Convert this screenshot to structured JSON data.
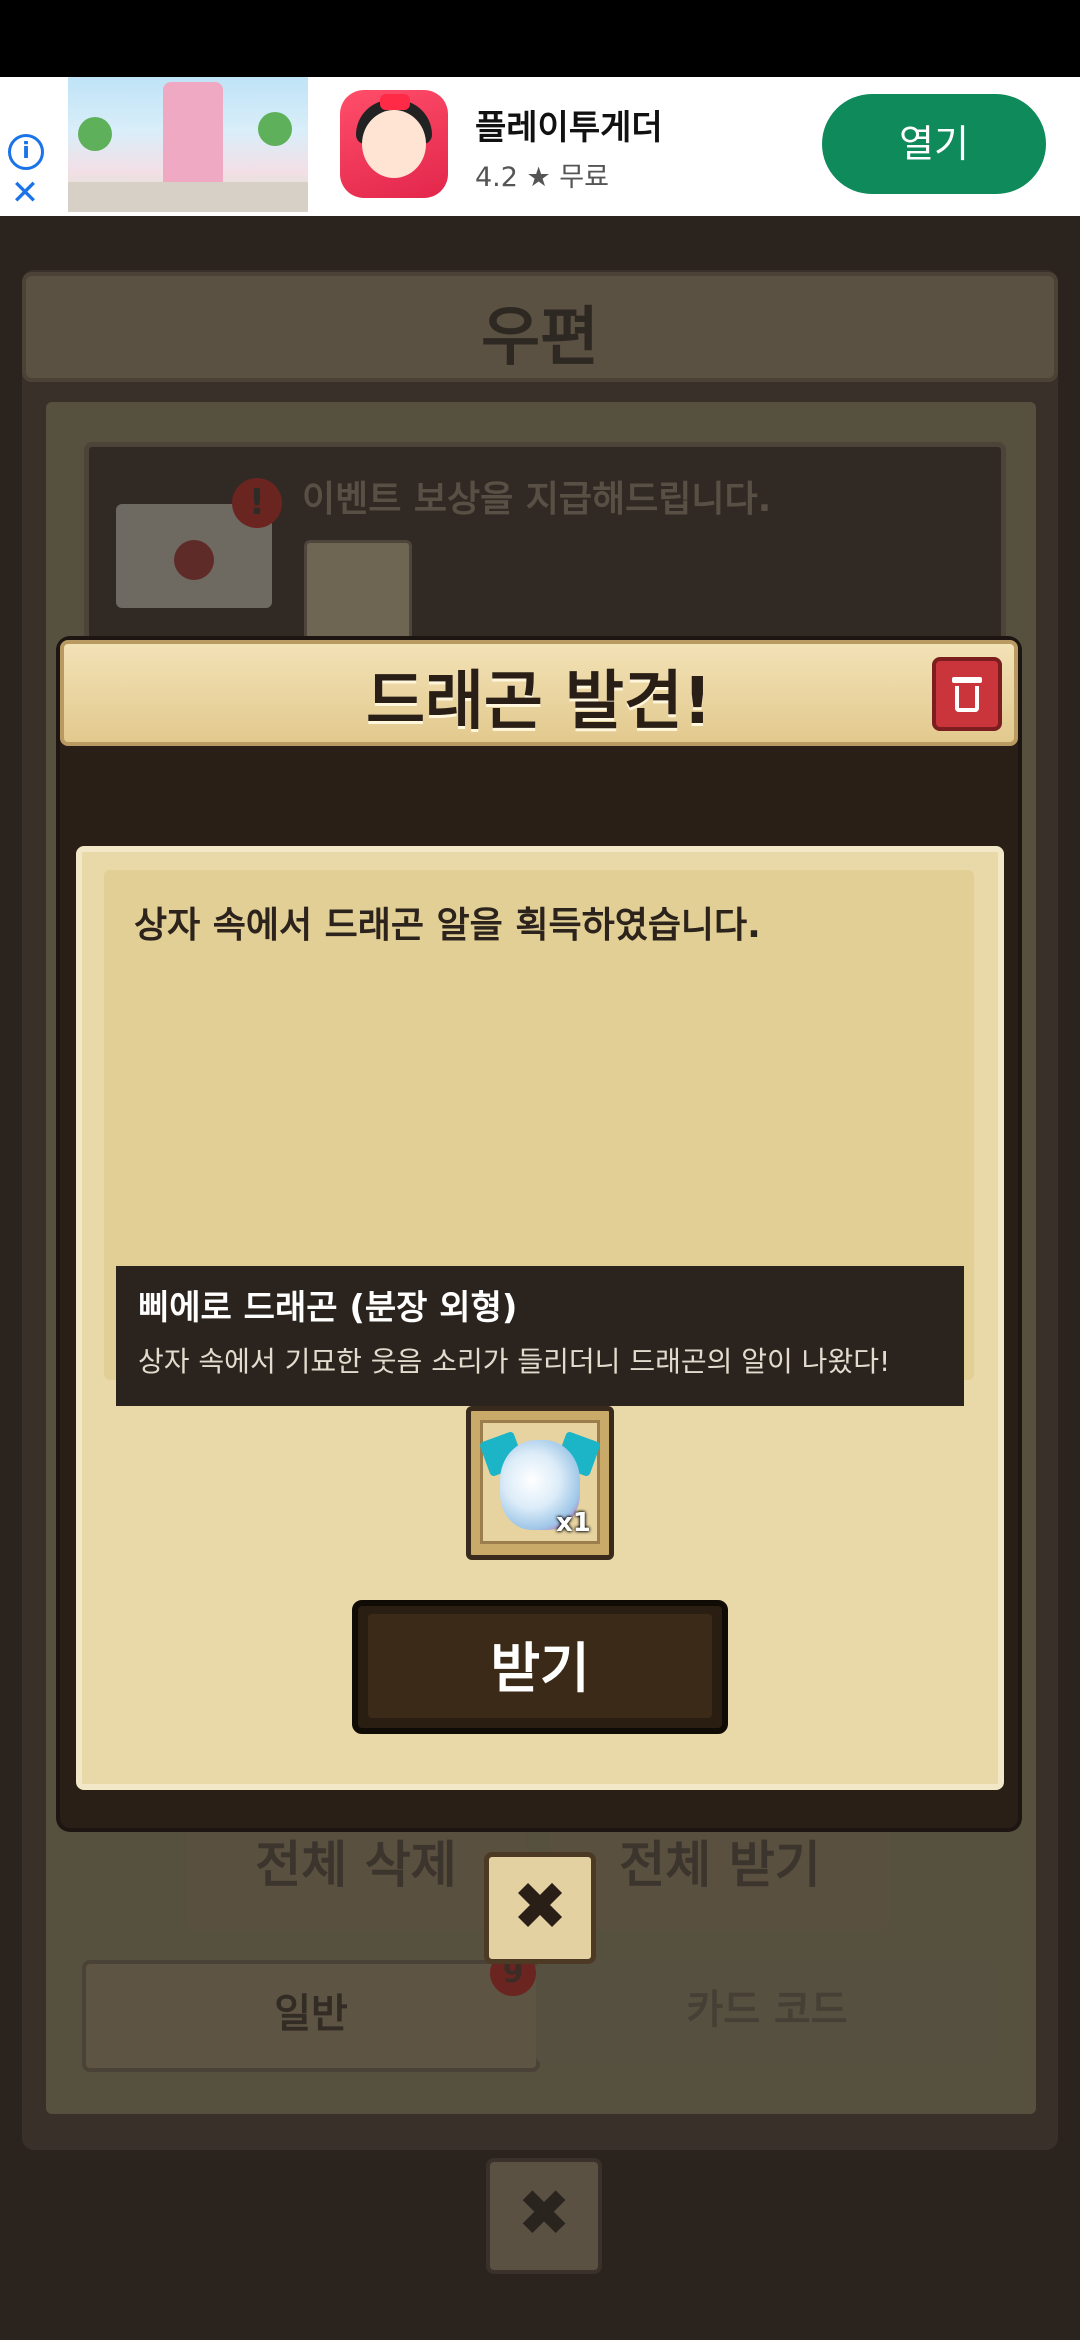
{
  "ad": {
    "title": "플레이투게더",
    "rating": "4.2 ★  무료",
    "open_label": "열기",
    "info_icon": "i",
    "close_icon": "✕"
  },
  "mail": {
    "title": "우편",
    "item_text": "이벤트 보상을 지급해드립니다.",
    "alert_icon": "!",
    "delete_all": "전체 삭제",
    "receive_all": "전체 받기",
    "tab_general": "일반",
    "tab_badge": "9",
    "tab_cardcode": "카드 코드",
    "close_icon": "✖"
  },
  "dialog": {
    "title": "드래곤 발견!",
    "message": "상자 속에서 드래곤 알을 획득하였습니다.",
    "item_name": "삐에로 드래곤 (분장 외형)",
    "item_desc": "상자 속에서 기묘한 웃음 소리가 들리더니 드래곤의 알이 나왔다!",
    "reward_qty": "x1",
    "receive_label": "받기",
    "close_icon": "✖"
  }
}
